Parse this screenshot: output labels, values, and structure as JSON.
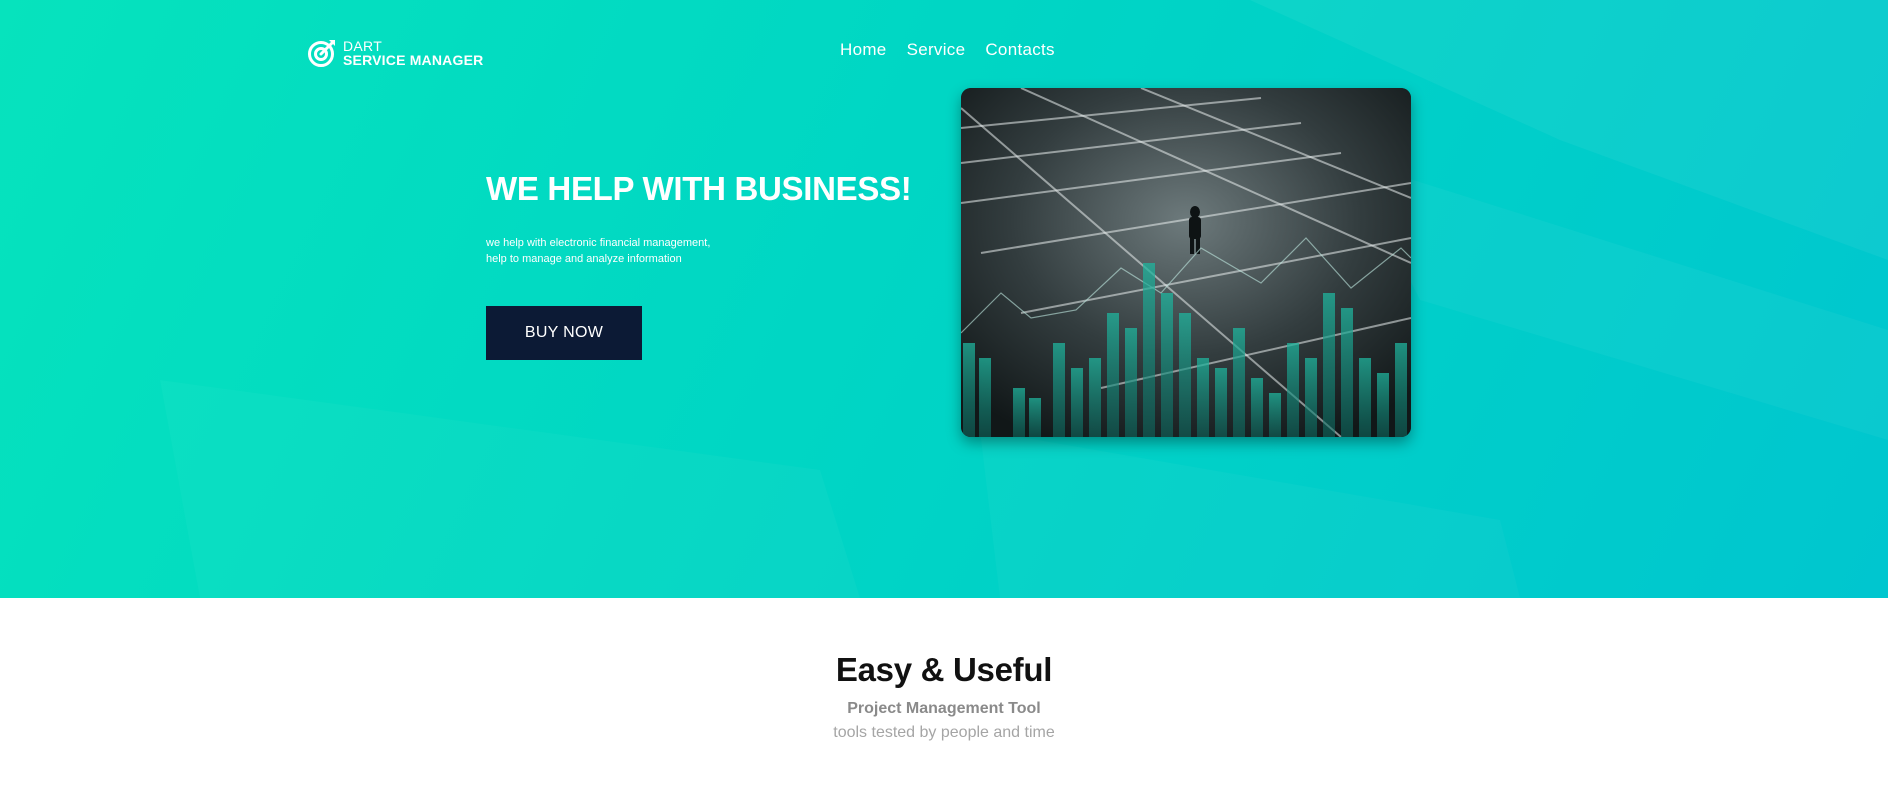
{
  "brand": {
    "line1": "DART",
    "line2": "SERVICE MANAGER",
    "icon": "target-logo-icon"
  },
  "nav": {
    "items": [
      {
        "label": "Home"
      },
      {
        "label": "Service"
      },
      {
        "label": "Contacts"
      }
    ]
  },
  "hero": {
    "headline": "WE HELP WITH BUSINESS!",
    "subtext_line1": "we help with electronic financial management,",
    "subtext_line2": "help to manage and analyze information",
    "cta_label": "BUY NOW",
    "image": "man-in-parking-lot-with-bar-chart-overlay"
  },
  "section": {
    "title": "Easy & Useful",
    "subtitle": "Project Management Tool",
    "tagline": "tools tested by people and time"
  },
  "colors": {
    "hero_gradient_start": "#06e3bd",
    "hero_gradient_end": "#00c6cf",
    "button_bg": "#0c1a35",
    "text_light": "#ffffff"
  }
}
